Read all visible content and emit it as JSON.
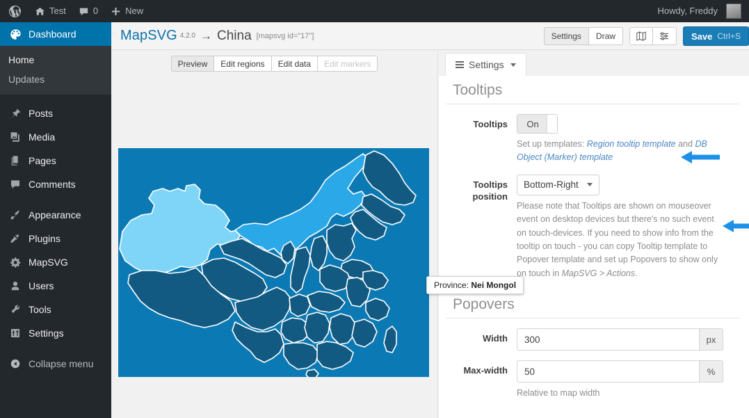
{
  "adminbar": {
    "logo_icon": "wordpress-logo-icon",
    "site_icon": "home-icon",
    "site_name": "Test",
    "comments_icon": "comment-bubble-icon",
    "comments_count": "0",
    "new_icon": "plus-icon",
    "new_label": "New",
    "howdy": "Howdy, Freddy"
  },
  "sidebar": {
    "items": [
      {
        "label": "Dashboard",
        "icon": "dashboard-icon",
        "current": true
      },
      {
        "label": "Posts",
        "icon": "pin-icon"
      },
      {
        "label": "Media",
        "icon": "media-icon"
      },
      {
        "label": "Pages",
        "icon": "pages-icon"
      },
      {
        "label": "Comments",
        "icon": "comment-bubble-icon"
      },
      {
        "label": "Appearance",
        "icon": "brush-icon"
      },
      {
        "label": "Plugins",
        "icon": "plug-icon"
      },
      {
        "label": "MapSVG",
        "icon": "gear-icon"
      },
      {
        "label": "Users",
        "icon": "user-icon"
      },
      {
        "label": "Tools",
        "icon": "wrench-icon"
      },
      {
        "label": "Settings",
        "icon": "sliders-icon"
      },
      {
        "label": "Collapse menu",
        "icon": "collapse-arrow-icon"
      }
    ],
    "submenu": [
      {
        "label": "Home"
      },
      {
        "label": "Updates"
      }
    ]
  },
  "header": {
    "brand": "MapSVG",
    "version": "4.2.0",
    "arrow": "→",
    "map_name": "China",
    "shortcode": "[mapsvg id=\"17\"]",
    "mode_buttons": [
      {
        "label": "Settings",
        "active": true
      },
      {
        "label": "Draw",
        "active": false
      }
    ],
    "icon_buttons": [
      {
        "icon": "folded-map-icon"
      },
      {
        "icon": "sliders-icon"
      }
    ],
    "save_label": "Save",
    "save_shortcut": "Ctrl+S",
    "save_color": "#1a7db5"
  },
  "preview": {
    "tabs": [
      {
        "label": "Preview",
        "active": true,
        "disabled": false
      },
      {
        "label": "Edit regions",
        "active": false,
        "disabled": false
      },
      {
        "label": "Edit data",
        "active": false,
        "disabled": false
      },
      {
        "label": "Edit markers",
        "active": false,
        "disabled": true
      }
    ],
    "map": {
      "background_color": "#0b7ab4",
      "region_color": "#125a82",
      "stroke_color": "#ffffff",
      "highlight_color": "#7fd5f8",
      "hover_color": "#2aa8e8",
      "hovered_region": "Nei Mongol"
    },
    "tooltip": {
      "label": "Province:",
      "value": "Nei Mongol"
    }
  },
  "settings": {
    "panel_tab": "Settings",
    "sections": [
      {
        "title": "Tooltips",
        "fields": [
          {
            "label": "Tooltips",
            "type": "toggle",
            "value": "On",
            "annotated": true,
            "help_prefix": "Set up templates: ",
            "help_link1": "Region tooltip template",
            "help_mid": " and ",
            "help_link2": "DB Object (Marker) template"
          },
          {
            "label": "Tooltips position",
            "type": "select",
            "value": "Bottom-Right",
            "annotated": true,
            "help": "Please note that Tooltips are shown on mouseover event on desktop devices but there's no such event on touch-devices. If you need to show info from the tooltip on touch - you can copy Tooltip template to Popover template and set up Popovers to show only on touch in ",
            "help_italic": "MapSVG > Actions",
            "help_tail": "."
          }
        ]
      },
      {
        "title": "Popovers",
        "fields": [
          {
            "label": "Width",
            "type": "input",
            "value": "300",
            "unit": "px"
          },
          {
            "label": "Max-width",
            "type": "input",
            "value": "50",
            "unit": "%",
            "help": "Relative to map width"
          }
        ]
      }
    ]
  },
  "annotation": {
    "arrow_color": "#1e90e8"
  }
}
